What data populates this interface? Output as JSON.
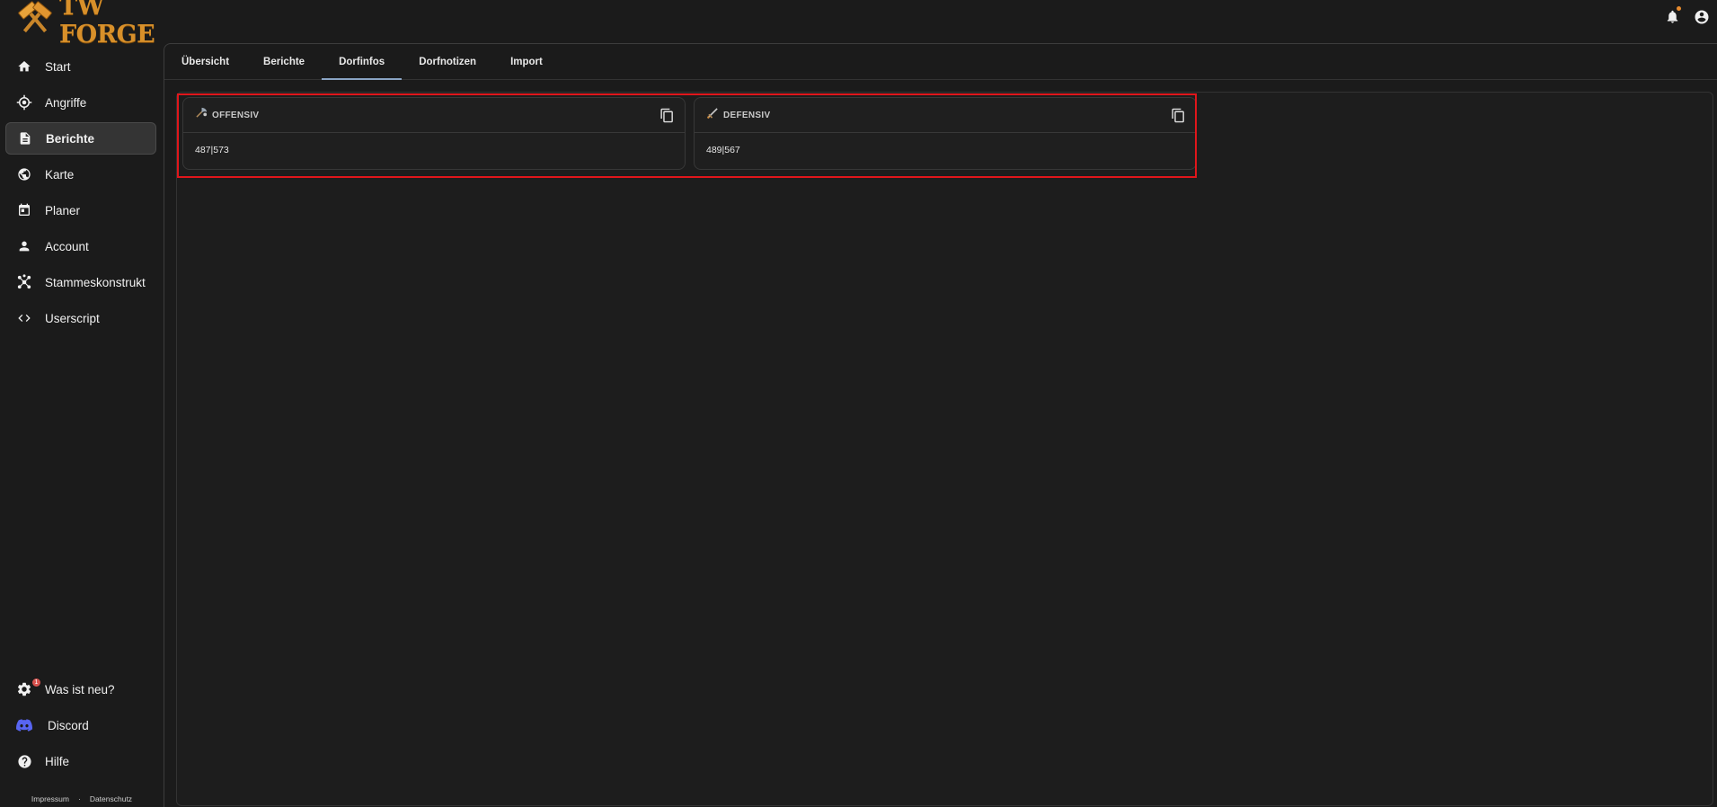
{
  "app": {
    "logo_text": "TW FORGE"
  },
  "sidebar": {
    "items": [
      {
        "label": "Start",
        "icon": "home-icon"
      },
      {
        "label": "Angriffe",
        "icon": "target-icon"
      },
      {
        "label": "Berichte",
        "icon": "document-icon",
        "active": true
      },
      {
        "label": "Karte",
        "icon": "globe-icon"
      },
      {
        "label": "Planer",
        "icon": "calendar-icon"
      },
      {
        "label": "Account",
        "icon": "person-icon"
      },
      {
        "label": "Stammeskonstrukt",
        "icon": "network-icon"
      },
      {
        "label": "Userscript",
        "icon": "code-icon"
      }
    ],
    "bottom_items": [
      {
        "label": "Was ist neu?",
        "icon": "gear-badge-icon",
        "badge": "1"
      },
      {
        "label": "Discord",
        "icon": "discord-icon"
      },
      {
        "label": "Hilfe",
        "icon": "help-icon"
      }
    ],
    "footer": {
      "impressum": "Impressum",
      "separator": "·",
      "datenschutz": "Datenschutz"
    }
  },
  "tabs": [
    {
      "label": "Übersicht"
    },
    {
      "label": "Berichte"
    },
    {
      "label": "Dorfinfos",
      "active": true
    },
    {
      "label": "Dorfnotizen"
    },
    {
      "label": "Import"
    }
  ],
  "cards": {
    "offensive": {
      "title": "OFFENSIV",
      "value": "487|573",
      "icon": "axe-icon"
    },
    "defensive": {
      "title": "DEFENSIV",
      "value": "489|567",
      "icon": "sword-icon"
    }
  },
  "colors": {
    "accent": "#d8902a",
    "highlight_border": "#e0161b",
    "tab_underline": "#8aa4c4"
  }
}
